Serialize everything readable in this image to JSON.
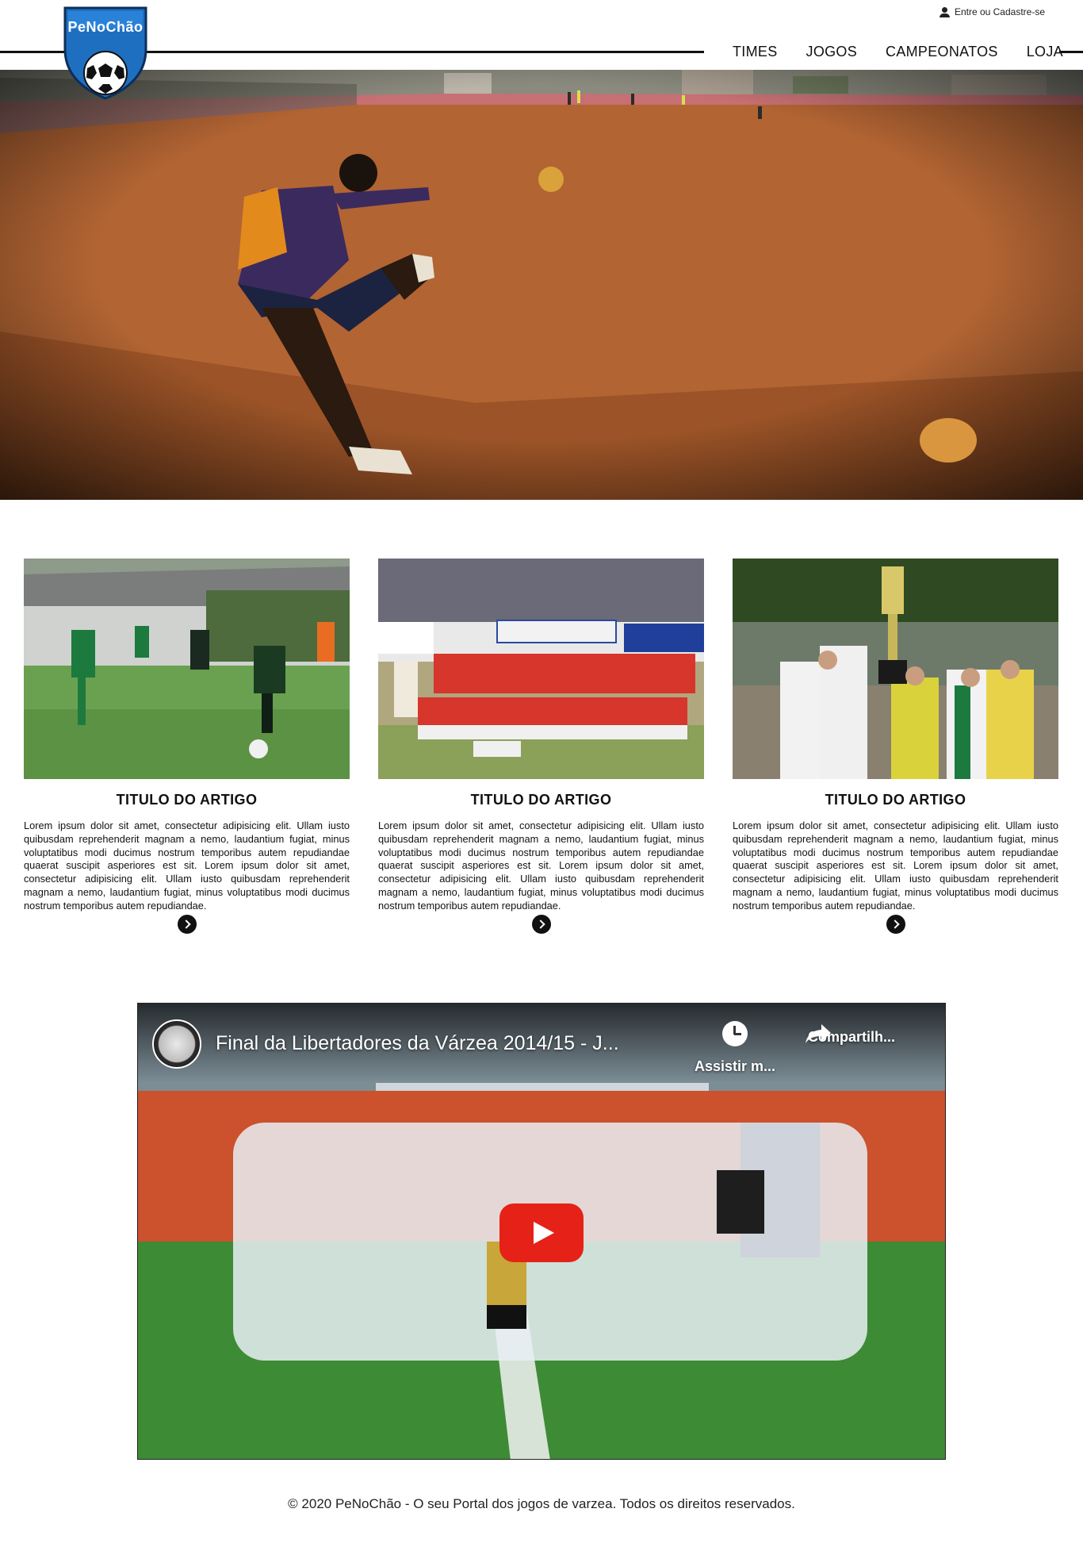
{
  "header": {
    "logo_text": "PeNoChão",
    "login_label": "Entre ou Cadastre-se",
    "nav": [
      "TIMES",
      "JOGOS",
      "CAMPEONATOS",
      "LOJA"
    ]
  },
  "articles": [
    {
      "title": "TITULO DO  ARTIGO",
      "body": "Lorem ipsum dolor sit amet, consectetur adipisicing elit. Ullam iusto quibusdam reprehenderit magnam a nemo, laudantium fugiat, minus voluptatibus modi ducimus nostrum temporibus autem repudiandae quaerat suscipit asperiores est sit. Lorem ipsum dolor sit amet, consectetur adipisicing elit. Ullam iusto quibusdam reprehenderit magnam a nemo, laudantium fugiat, minus voluptatibus modi ducimus nostrum temporibus autem repudiandae."
    },
    {
      "title": "TITULO DO  ARTIGO",
      "body": "Lorem ipsum dolor sit amet, consectetur adipisicing elit. Ullam iusto quibusdam reprehenderit magnam a nemo, laudantium fugiat, minus voluptatibus modi ducimus nostrum temporibus autem repudiandae quaerat suscipit asperiores est sit. Lorem ipsum dolor sit amet, consectetur adipisicing elit. Ullam iusto quibusdam reprehenderit magnam a nemo, laudantium fugiat, minus voluptatibus modi ducimus nostrum temporibus autem repudiandae."
    },
    {
      "title": "TITULO DO  ARTIGO",
      "body": "Lorem ipsum dolor sit amet, consectetur adipisicing elit. Ullam iusto quibusdam reprehenderit magnam a nemo, laudantium fugiat, minus voluptatibus modi ducimus nostrum temporibus autem repudiandae quaerat suscipit asperiores est sit. Lorem ipsum dolor sit amet, consectetur adipisicing elit. Ullam iusto quibusdam reprehenderit magnam a nemo, laudantium fugiat, minus voluptatibus modi ducimus nostrum temporibus autem repudiandae."
    }
  ],
  "video": {
    "title": "Final da Libertadores da Várzea 2014/15 - J...",
    "watch_later": "Assistir m...",
    "share": "Compartilh..."
  },
  "footer": {
    "text": "© 2020 PeNoChão - O seu Portal dos jogos de varzea. Todos os direitos reservados."
  },
  "colors": {
    "logo_blue": "#1f6fc0",
    "youtube_red": "#e62117"
  }
}
